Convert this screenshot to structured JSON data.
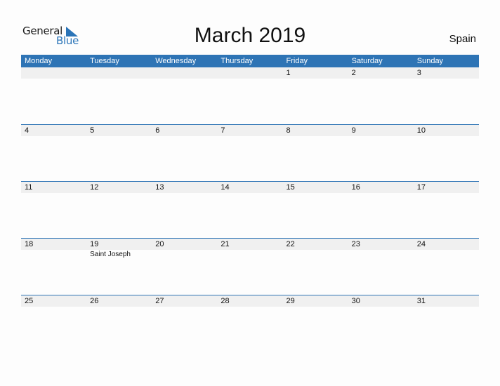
{
  "brand": {
    "word1": "General",
    "word2": "Blue",
    "accent": "#2e74b5"
  },
  "title": "March 2019",
  "country": "Spain",
  "weekdays": [
    "Monday",
    "Tuesday",
    "Wednesday",
    "Thursday",
    "Friday",
    "Saturday",
    "Sunday"
  ],
  "weeks": [
    {
      "days": [
        "",
        "",
        "",
        "",
        "1",
        "2",
        "3"
      ],
      "holidays": [
        "",
        "",
        "",
        "",
        "",
        "",
        ""
      ]
    },
    {
      "days": [
        "4",
        "5",
        "6",
        "7",
        "8",
        "9",
        "10"
      ],
      "holidays": [
        "",
        "",
        "",
        "",
        "",
        "",
        ""
      ]
    },
    {
      "days": [
        "11",
        "12",
        "13",
        "14",
        "15",
        "16",
        "17"
      ],
      "holidays": [
        "",
        "",
        "",
        "",
        "",
        "",
        ""
      ]
    },
    {
      "days": [
        "18",
        "19",
        "20",
        "21",
        "22",
        "23",
        "24"
      ],
      "holidays": [
        "",
        "Saint Joseph",
        "",
        "",
        "",
        "",
        ""
      ]
    },
    {
      "days": [
        "25",
        "26",
        "27",
        "28",
        "29",
        "30",
        "31"
      ],
      "holidays": [
        "",
        "",
        "",
        "",
        "",
        "",
        ""
      ]
    }
  ]
}
